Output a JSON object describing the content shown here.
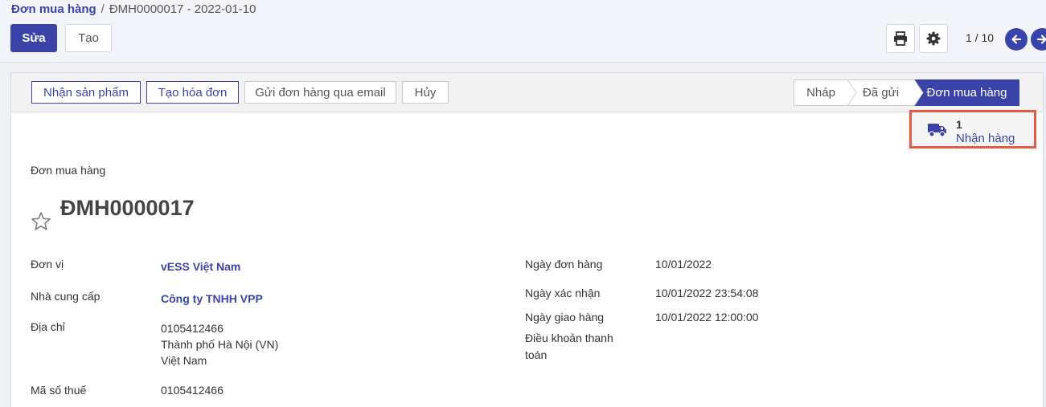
{
  "breadcrumb": {
    "parent": "Đơn mua hàng",
    "separator": "/",
    "current": "ĐMH0000017 - 2022-01-10"
  },
  "toolbar": {
    "edit_label": "Sửa",
    "create_label": "Tạo"
  },
  "pager": {
    "text": "1 / 10"
  },
  "icons": {
    "print": "printer-icon",
    "settings": "gear-icon",
    "prev": "arrow-left-icon",
    "next": "arrow-right-icon",
    "truck": "truck-icon",
    "star": "star-icon"
  },
  "actions": {
    "receive": "Nhận sản phẩm",
    "invoice": "Tạo hóa đơn",
    "email": "Gửi đơn hàng qua email",
    "cancel": "Hủy"
  },
  "states": {
    "draft": "Nháp",
    "sent": "Đã gửi",
    "purchase": "Đơn mua hàng"
  },
  "smart_button": {
    "count": "1",
    "label": "Nhận hàng"
  },
  "document": {
    "type_label": "Đơn mua hàng",
    "title": "ĐMH0000017"
  },
  "fields_left": {
    "unit_label": "Đơn vị",
    "unit_value": "vESS Việt Nam",
    "vendor_label": "Nhà cung cấp",
    "vendor_value": "Công ty TNHH VPP",
    "address_label": "Địa chỉ",
    "address_line1": "0105412466",
    "address_line2": "Thành phố Hà Nội (VN)",
    "address_line3": "Việt Nam",
    "tax_label": "Mã số thuế",
    "tax_value": "0105412466"
  },
  "fields_right": {
    "order_date_label": "Ngày đơn hàng",
    "order_date_value": "10/01/2022",
    "confirm_date_label": "Ngày xác nhận",
    "confirm_date_value": "10/01/2022 23:54:08",
    "delivery_date_label": "Ngày giao hàng",
    "delivery_date_value": "10/01/2022 12:00:00",
    "payment_terms_label_1": "Điều khoản thanh",
    "payment_terms_label_2": "toán"
  },
  "colors": {
    "primary": "#3a44a8",
    "highlight": "#e35a47"
  }
}
